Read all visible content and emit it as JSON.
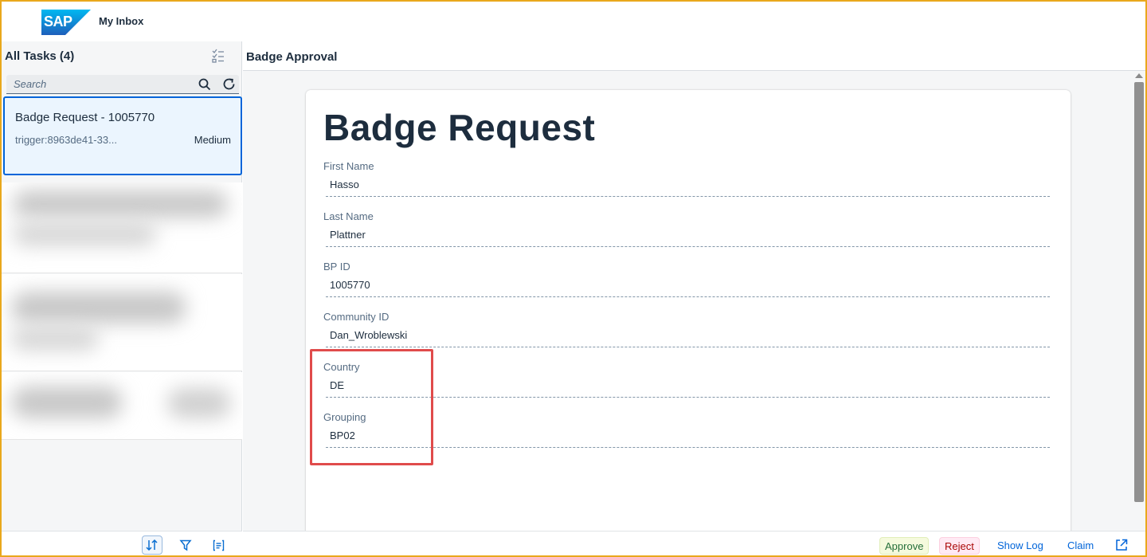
{
  "shell": {
    "logo_text": "SAP",
    "title": "My Inbox"
  },
  "master": {
    "title": "All Tasks (4)",
    "search_placeholder": "Search",
    "search_value": "",
    "selected_task": {
      "title": "Badge Request - 1005770",
      "subtitle": "trigger:8963de41-33...",
      "priority": "Medium"
    },
    "footer_icons": [
      "sort-icon",
      "filter-icon",
      "group-icon"
    ]
  },
  "detail": {
    "header_title": "Badge Approval",
    "form_title": "Badge Request",
    "fields": [
      {
        "label": "First Name",
        "value": "Hasso"
      },
      {
        "label": "Last Name",
        "value": "Plattner"
      },
      {
        "label": "BP ID",
        "value": "1005770"
      },
      {
        "label": "Community ID",
        "value": "Dan_Wroblewski"
      },
      {
        "label": "Country",
        "value": "DE"
      },
      {
        "label": "Grouping",
        "value": "BP02"
      }
    ],
    "footer": {
      "approve": "Approve",
      "reject": "Reject",
      "show_log": "Show Log",
      "claim": "Claim"
    }
  },
  "colors": {
    "accent": "#0064d9",
    "highlight": "#e04b4b",
    "approve_text": "#256f3a",
    "reject_text": "#aa0808",
    "frame": "#e9a81c"
  }
}
